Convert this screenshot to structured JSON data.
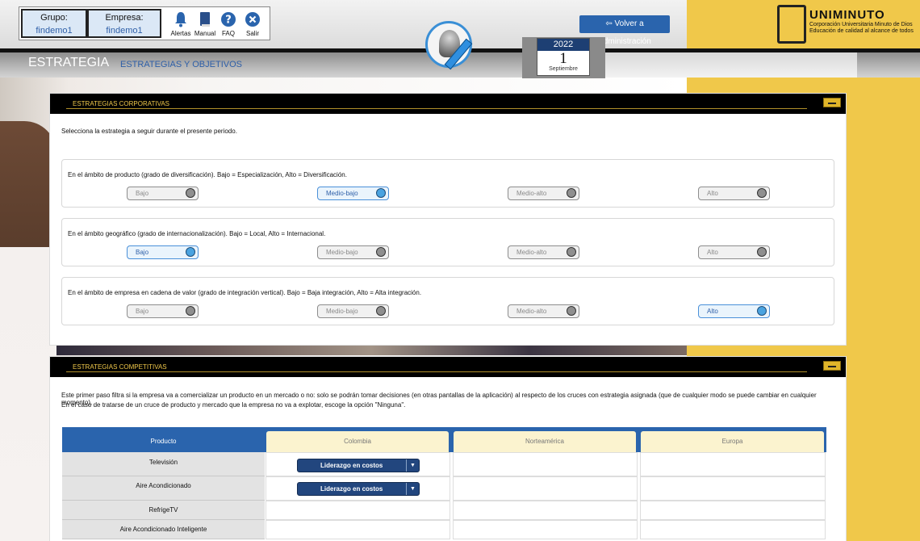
{
  "header": {
    "group_label": "Grupo:",
    "group_value": "findemo1",
    "company_label": "Empresa:",
    "company_value": "findemo1",
    "icons": [
      {
        "name": "bell-icon",
        "label": "Alertas"
      },
      {
        "name": "book-icon",
        "label": "Manual"
      },
      {
        "name": "question-icon",
        "label": "FAQ"
      },
      {
        "name": "close-icon",
        "label": "Salir"
      }
    ],
    "back_button": "Volver a Administración",
    "calendar": {
      "year": "2022",
      "day": "1",
      "month": "Septiembre"
    },
    "university": {
      "name": "UNIMINUTO",
      "line1": "Corporación Universitaria Minuto de Dios",
      "line2": "Educación de calidad al alcance de todos"
    }
  },
  "section": {
    "title": "ESTRATEGIA",
    "subtitle": "ESTRATEGIAS Y OBJETIVOS"
  },
  "corporate": {
    "title": "ESTRATEGIAS CORPORATIVAS",
    "intro": "Selecciona la estrategia a seguir durante el presente periodo.",
    "questions": [
      {
        "text": "En el ámbito de producto (grado de diversificación). Bajo = Especialización, Alto = Diversificación.",
        "options": [
          "Bajo",
          "Medio-bajo",
          "Medio-alto",
          "Alto"
        ],
        "selected": 1
      },
      {
        "text": "En el ámbito geográfico (grado de internacionalización). Bajo = Local, Alto = Internacional.",
        "options": [
          "Bajo",
          "Medio-bajo",
          "Medio-alto",
          "Alto"
        ],
        "selected": 0
      },
      {
        "text": "En el ámbito de empresa en cadena de valor (grado de integración vertical). Bajo = Baja integración, Alto = Alta integración.",
        "options": [
          "Bajo",
          "Medio-bajo",
          "Medio-alto",
          "Alto"
        ],
        "selected": 3
      }
    ]
  },
  "competitive": {
    "title": "ESTRATEGIAS COMPETITIVAS",
    "intro1": "Este primer paso filtra si la empresa va a comercializar un producto en un mercado o no: solo se podrán tomar decisiones (en otras pantallas de la aplicación) al respecto de los cruces con estrategia asignada (que de cualquier modo se puede cambiar en cualquier momento).",
    "intro2": "En el caso de tratarse de un cruce de producto y mercado que la empresa no va a explotar, escoge la opción \"Ninguna\".",
    "table": {
      "product_header": "Producto",
      "markets": [
        "Colombia",
        "Norteamérica",
        "Europa"
      ],
      "rows": [
        {
          "product": "Televisión",
          "cells": [
            "Liderazgo en costos",
            "",
            ""
          ]
        },
        {
          "product": "Aire Acondicionado",
          "cells": [
            "Liderazgo en costos",
            "",
            ""
          ]
        },
        {
          "product": "RefrigeTV",
          "cells": [
            "",
            "",
            ""
          ]
        },
        {
          "product": "Aire Acondicionado Inteligente",
          "cells": [
            "",
            "",
            ""
          ]
        }
      ]
    }
  }
}
